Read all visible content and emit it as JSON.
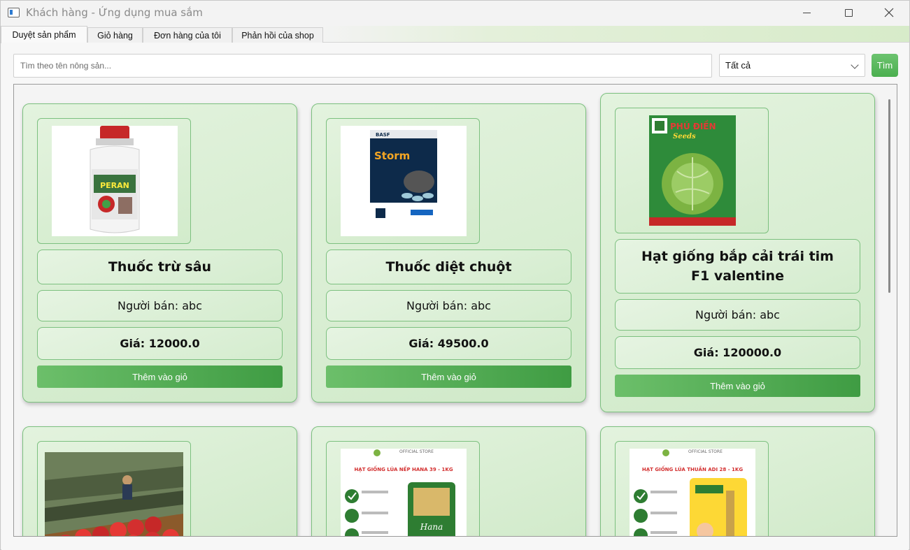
{
  "window": {
    "title": "Khách hàng - Ứng dụng mua sắm"
  },
  "tabs": [
    {
      "label": "Duyệt sản phẩm",
      "active": true
    },
    {
      "label": "Giỏ hàng",
      "active": false
    },
    {
      "label": "Đơn hàng của tôi",
      "active": false
    },
    {
      "label": "Phản hồi của shop",
      "active": false
    }
  ],
  "search": {
    "placeholder": "Tìm theo tên nông sản...",
    "value": "",
    "button_label": "Tìm"
  },
  "category": {
    "selected": "Tất cả"
  },
  "products": [
    {
      "name": "Thuốc trừ sâu",
      "seller": "Người bán: abc",
      "price": "Giá: 12000.0",
      "add_label": "Thêm vào giỏ",
      "image": "pesticide-bottle",
      "image_text": "PERAN"
    },
    {
      "name": "Thuốc diệt chuột",
      "seller": "Người bán: abc",
      "price": "Giá: 49500.0",
      "add_label": "Thêm vào giỏ",
      "image": "rodenticide-pack",
      "image_text": "Storm"
    },
    {
      "name": "Hạt giống bắp cải trái tim F1 valentine",
      "seller": "Người bán: abc",
      "price": "Giá: 120000.0",
      "add_label": "Thêm vào giỏ",
      "image": "cabbage-seed-pack",
      "image_text": "PHÚ ĐIỀN"
    },
    {
      "image": "strawberry-field"
    },
    {
      "image": "rice-seed-hana",
      "image_text": "HẠT GIỐNG LÚA NẾP HANA 39 - 1KG"
    },
    {
      "image": "rice-seed-adi",
      "image_text": "HẠT GIỐNG LÚA THUẦN ADI 28 - 1KG"
    }
  ],
  "colors": {
    "accent": "#4caf50",
    "card_border": "#7cc07f",
    "card_bg": "#d8eed2"
  }
}
